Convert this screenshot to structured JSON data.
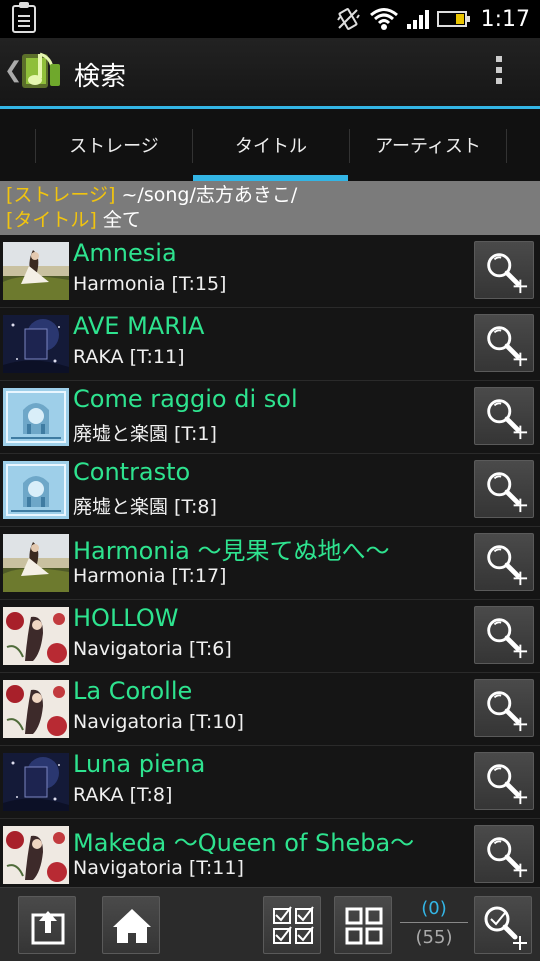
{
  "status_bar": {
    "time": "1:17"
  },
  "action_bar": {
    "title": "検索"
  },
  "tabs": [
    {
      "label": "ストレージ",
      "selected": false
    },
    {
      "label": "タイトル",
      "selected": true
    },
    {
      "label": "アーティスト",
      "selected": false
    }
  ],
  "filter": {
    "storage_label": "[ストレージ]",
    "storage_value": " ~/song/志方あきこ/",
    "title_label": "[タイトル]",
    "title_value": " 全て"
  },
  "songs": [
    {
      "title": "Amnesia",
      "detail": "Harmonia [T:15]",
      "art": "art-harmonia"
    },
    {
      "title": "AVE MARIA",
      "detail": "RAKA [T:11]",
      "art": "art-raka"
    },
    {
      "title": "Come raggio di sol",
      "detail": "廃墟と楽園 [T:1]",
      "art": "art-haikyo"
    },
    {
      "title": "Contrasto",
      "detail": "廃墟と楽園 [T:8]",
      "art": "art-haikyo"
    },
    {
      "title": "Harmonia ～見果てぬ地へ～",
      "detail": "Harmonia [T:17]",
      "art": "art-harmonia"
    },
    {
      "title": "HOLLOW",
      "detail": "Navigatoria [T:6]",
      "art": "art-navigatoria"
    },
    {
      "title": "La Corolle",
      "detail": "Navigatoria [T:10]",
      "art": "art-navigatoria"
    },
    {
      "title": "Luna piena",
      "detail": "RAKA [T:8]",
      "art": "art-raka"
    },
    {
      "title": "Makeda ～Queen of Sheba～",
      "detail": "Navigatoria [T:11]",
      "art": "art-navigatoria"
    }
  ],
  "bottom_bar": {
    "selected_count": "(0)",
    "total_count": "(55)"
  },
  "colors": {
    "accent": "#33b5e5",
    "song_title": "#2ee38f",
    "filter_label": "#f1c40f"
  }
}
